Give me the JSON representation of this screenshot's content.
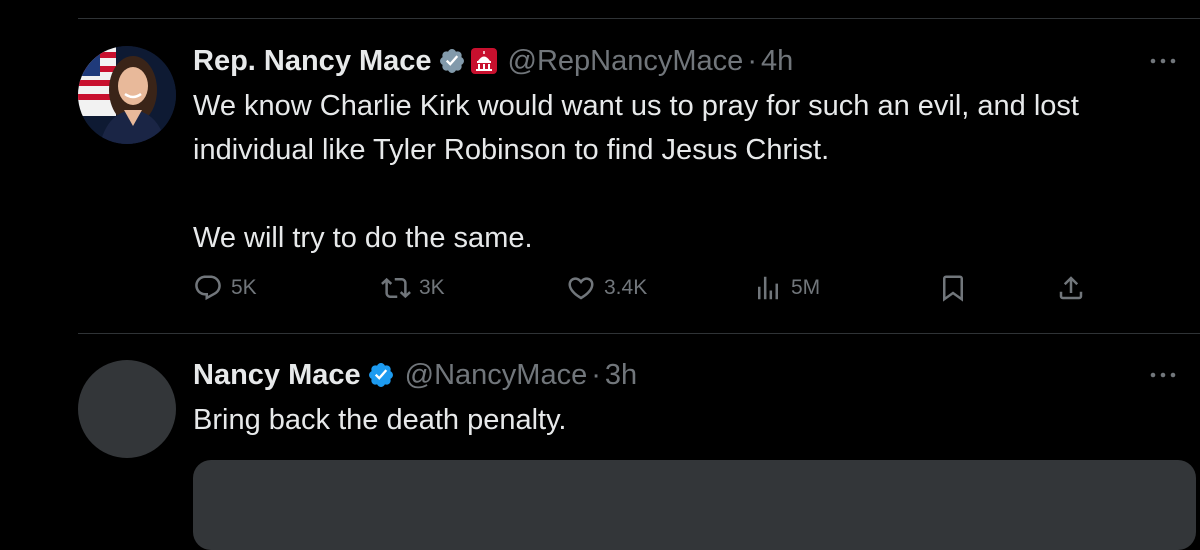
{
  "colors": {
    "background": "#000000",
    "primary_text": "#e7e9ea",
    "secondary_text": "#71767b",
    "divider": "#2f3336",
    "verified_blue": "#1d9bf0",
    "verified_gray": "#829aab",
    "gov_badge_red": "#c8102e"
  },
  "tweets": [
    {
      "display_name": "Rep. Nancy Mace",
      "verified_badge": "gray-check-icon",
      "affiliation_badge": "capitol-icon",
      "handle": "@RepNancyMace",
      "separator": "·",
      "time": "4h",
      "text": "We know Charlie Kirk would want us to pray for such an evil, and lost individual like Tyler Robinson to find Jesus Christ.\n\nWe will try to do the same.",
      "actions": {
        "replies": "5K",
        "retweets": "3K",
        "likes": "3.4K",
        "views": "5M"
      }
    },
    {
      "display_name": "Nancy Mace",
      "verified_badge": "blue-check-icon",
      "handle": "@NancyMace",
      "separator": "·",
      "time": "3h",
      "text": "Bring back the death penalty."
    }
  ]
}
